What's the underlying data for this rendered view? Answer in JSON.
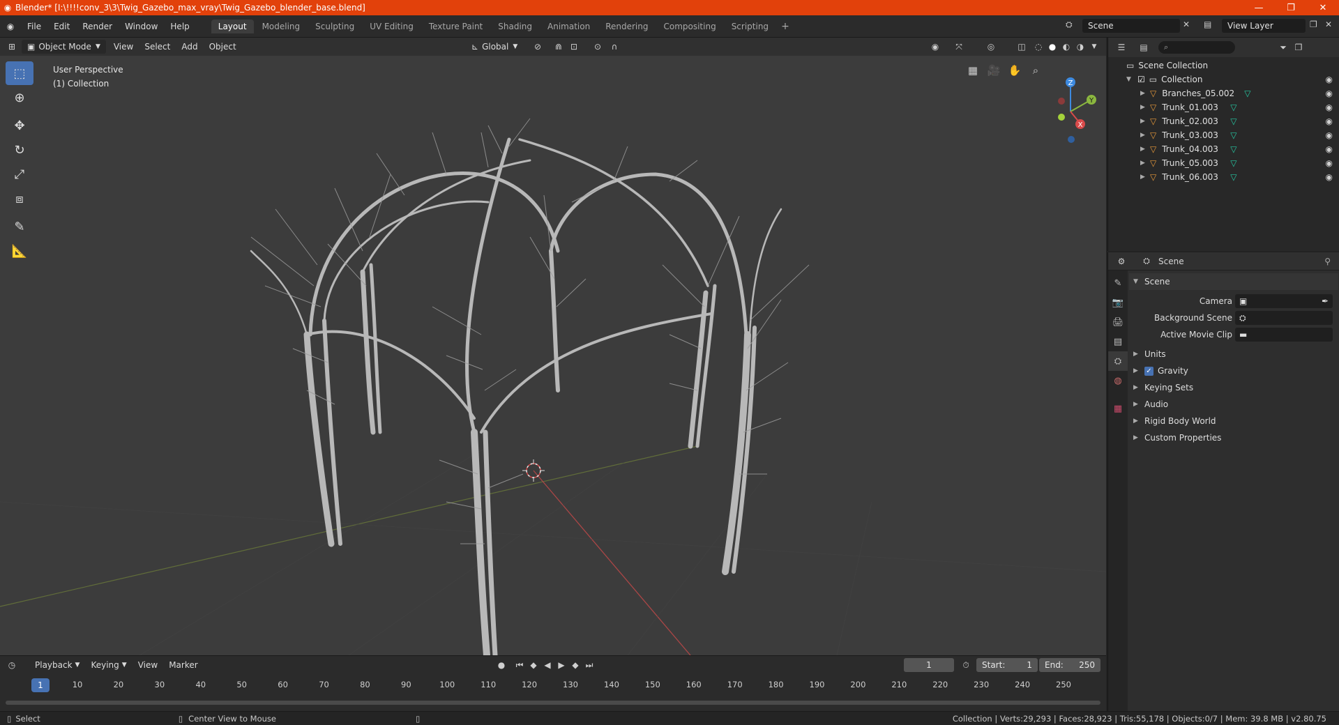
{
  "window": {
    "title": "Blender* [I:\\!!!!conv_3\\3\\Twig_Gazebo_max_vray\\Twig_Gazebo_blender_base.blend]",
    "logo": "blender-icon",
    "minimize": "—",
    "maximize": "❐",
    "close": "✕"
  },
  "menu": [
    "File",
    "Edit",
    "Render",
    "Window",
    "Help"
  ],
  "workspaces": [
    "Layout",
    "Modeling",
    "Sculpting",
    "UV Editing",
    "Texture Paint",
    "Shading",
    "Animation",
    "Rendering",
    "Compositing",
    "Scripting"
  ],
  "workspace_active": "Layout",
  "workspace_add": "+",
  "scene_field": "Scene",
  "viewlayer_field": "View Layer",
  "viewport": {
    "mode": "Object Mode",
    "menus": [
      "View",
      "Select",
      "Add",
      "Object"
    ],
    "transform": "Global",
    "info_line1": "User Perspective",
    "info_line2": "(1) Collection",
    "gizmo": {
      "z": "Z",
      "y": "Y",
      "x": "X"
    }
  },
  "outliner": {
    "search_placeholder": "⌕",
    "scene_collection": "Scene Collection",
    "collection": "Collection",
    "items": [
      "Branches_05.002",
      "Trunk_01.003",
      "Trunk_02.003",
      "Trunk_03.003",
      "Trunk_04.003",
      "Trunk_05.003",
      "Trunk_06.003"
    ]
  },
  "properties": {
    "header": "Scene",
    "panel_title": "Scene",
    "camera_label": "Camera",
    "bg_scene_label": "Background Scene",
    "movie_clip_label": "Active Movie Clip",
    "sections": [
      "Units",
      "Gravity",
      "Keying Sets",
      "Audio",
      "Rigid Body World",
      "Custom Properties"
    ]
  },
  "timeline": {
    "menus": [
      "Playback",
      "Keying",
      "View",
      "Marker"
    ],
    "current_frame": "1",
    "start_label": "Start:",
    "start": "1",
    "end_label": "End:",
    "end": "250",
    "ticks": [
      "1",
      "10",
      "20",
      "30",
      "40",
      "50",
      "60",
      "70",
      "80",
      "90",
      "100",
      "110",
      "120",
      "130",
      "140",
      "150",
      "160",
      "170",
      "180",
      "190",
      "200",
      "210",
      "220",
      "230",
      "240",
      "250"
    ]
  },
  "status": {
    "left": "Select",
    "middle": "Center View to Mouse",
    "right": "Collection | Verts:29,293 | Faces:28,923 | Tris:55,178 | Objects:0/7 | Mem: 39.8 MB | v2.80.75"
  },
  "colors": {
    "accent": "#4772b3",
    "title_bar": "#e2410b",
    "x_axis": "#d84a4a",
    "y_axis": "#8bb73f",
    "z_axis": "#3d8ae0"
  }
}
